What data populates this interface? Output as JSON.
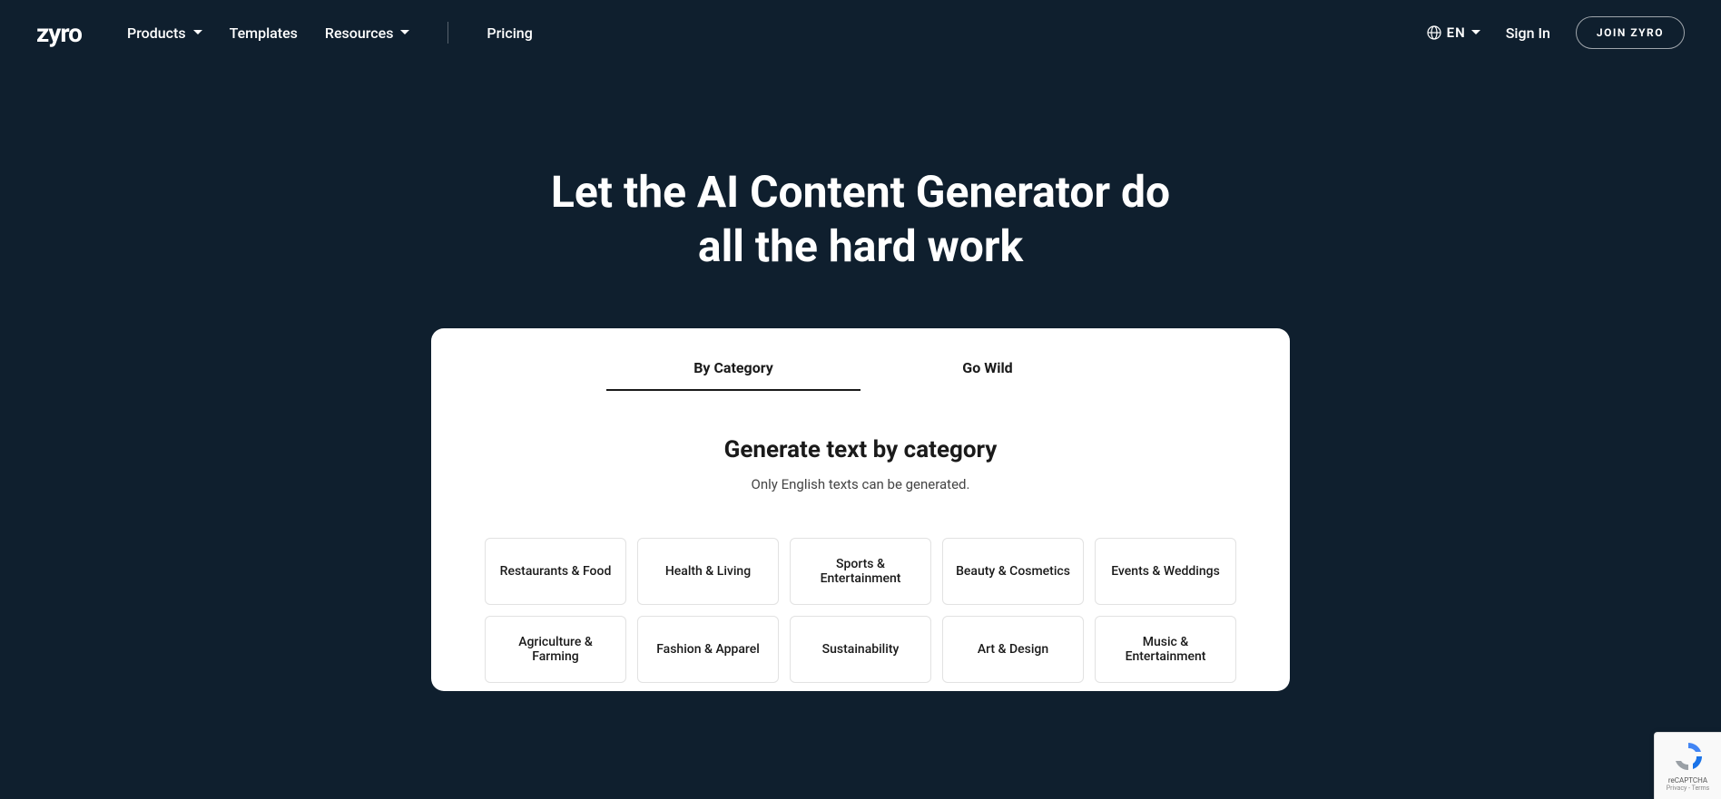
{
  "brand": {
    "name": "zyro"
  },
  "nav": {
    "products": "Products",
    "templates": "Templates",
    "resources": "Resources",
    "pricing": "Pricing"
  },
  "header": {
    "language": "EN",
    "sign_in": "Sign In",
    "join": "JOIN ZYRO"
  },
  "hero": {
    "line1": "Let the AI Content Generator do",
    "line2": "all the hard work"
  },
  "card": {
    "tabs": {
      "by_category": "By Category",
      "go_wild": "Go Wild"
    },
    "title": "Generate text by category",
    "subtitle": "Only English texts can be generated.",
    "categories": [
      "Restaurants & Food",
      "Health & Living",
      "Sports & Entertainment",
      "Beauty & Cosmetics",
      "Events & Weddings",
      "Agriculture & Farming",
      "Fashion & Apparel",
      "Sustainability",
      "Art & Design",
      "Music & Entertainment"
    ]
  },
  "recaptcha": {
    "label": "reCAPTCHA",
    "links": "Privacy - Terms"
  }
}
